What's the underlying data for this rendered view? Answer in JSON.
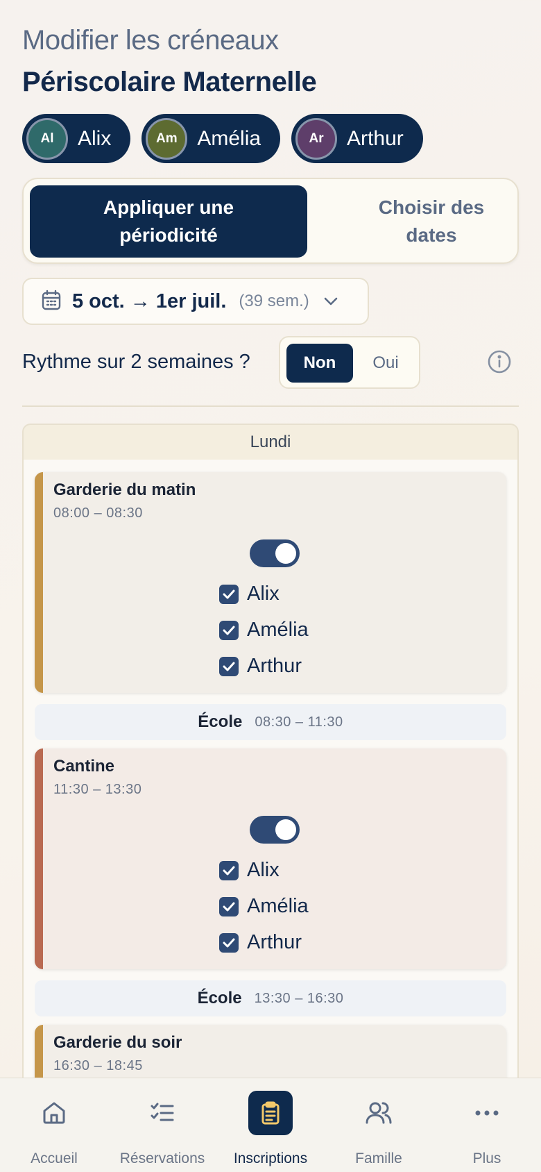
{
  "header": {
    "subtitle": "Modifier les créneaux",
    "title": "Périscolaire Maternelle"
  },
  "children": [
    {
      "initials": "Al",
      "name": "Alix",
      "color": "#2f6a6a"
    },
    {
      "initials": "Am",
      "name": "Amélia",
      "color": "#5d6b31"
    },
    {
      "initials": "Ar",
      "name": "Arthur",
      "color": "#5e3e6a"
    }
  ],
  "mode": {
    "periodicity": "Appliquer une périodicité",
    "dates": "Choisir des dates",
    "selected": "periodicity"
  },
  "range": {
    "label": "5 oct. → 1er juil.",
    "weeks": "(39 sem.)",
    "icon": "calendar-icon"
  },
  "rhythm": {
    "label": "Rythme sur 2 semaines ?",
    "no": "Non",
    "yes": "Oui",
    "selected": "Non"
  },
  "day": {
    "name": "Lundi",
    "slots": [
      {
        "name": "Garderie du matin",
        "time": "08:00 – 08:30",
        "enabled": true,
        "accent": "#c5964a",
        "bg": "#f2eee8",
        "kids": [
          "Alix",
          "Amélia",
          "Arthur"
        ]
      },
      {
        "school_label": "École",
        "school_time": "08:30 – 11:30"
      },
      {
        "name": "Cantine",
        "time": "11:30 – 13:30",
        "enabled": true,
        "accent": "#b96a52",
        "bg": "#f3ebe6",
        "kids": [
          "Alix",
          "Amélia",
          "Arthur"
        ]
      },
      {
        "school_label": "École",
        "school_time": "13:30 – 16:30"
      },
      {
        "name": "Garderie du soir",
        "time": "16:30 – 18:45",
        "accent": "#c5964a",
        "bg": "#f2eee8"
      }
    ]
  },
  "nav": [
    {
      "label": "Accueil",
      "icon": "home-icon"
    },
    {
      "label": "Réservations",
      "icon": "checklist-icon"
    },
    {
      "label": "Inscriptions",
      "icon": "clipboard-icon",
      "active": true
    },
    {
      "label": "Famille",
      "icon": "users-icon"
    },
    {
      "label": "Plus",
      "icon": "more-icon"
    }
  ]
}
